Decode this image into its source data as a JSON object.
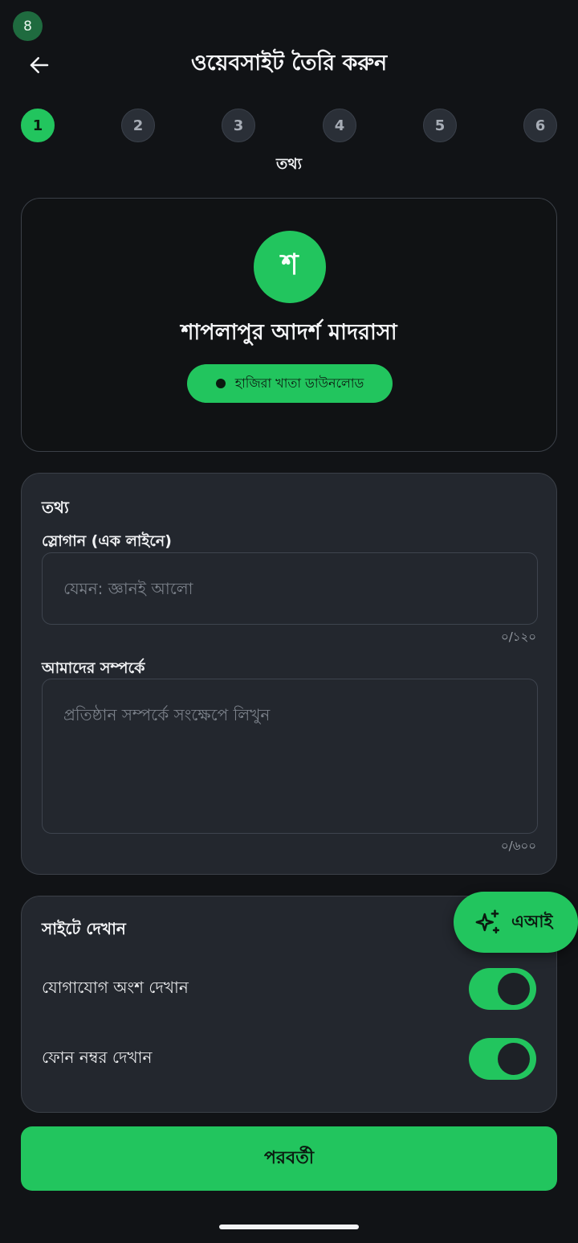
{
  "status": {
    "notification_count": "8"
  },
  "header": {
    "title": "ওয়েবসাইট তৈরি করুন"
  },
  "stepper": {
    "steps": [
      "1",
      "2",
      "3",
      "4",
      "5",
      "6"
    ],
    "active_index": 0,
    "current_label": "তথ্য"
  },
  "preview": {
    "avatar_letter": "শ",
    "institution_name": "শাপলাপুর আদর্শ মাদরাসা",
    "button_label": "হাজিরা খাতা ডাউনলোড"
  },
  "info_section": {
    "title": "তথ্য",
    "slogan": {
      "label": "স্লোগান (এক লাইনে)",
      "value": "",
      "placeholder": "যেমন: জ্ঞানই আলো",
      "counter": "০/১২০"
    },
    "about": {
      "label": "আমাদের সম্পর্কে",
      "value": "",
      "placeholder": "প্রতিষ্ঠান সম্পর্কে সংক্ষেপে লিখুন",
      "counter": "০/৬০০"
    }
  },
  "display_section": {
    "title": "সাইটে দেখান",
    "toggles": [
      {
        "label": "যোগাযোগ অংশ দেখান",
        "on": true
      },
      {
        "label": "ফোন নম্বর দেখান",
        "on": true
      }
    ]
  },
  "ai_button": {
    "label": "এআই"
  },
  "footer": {
    "next_label": "পরবর্তী"
  },
  "colors": {
    "accent": "#22c55e",
    "background": "#111316",
    "card": "#23272e"
  }
}
